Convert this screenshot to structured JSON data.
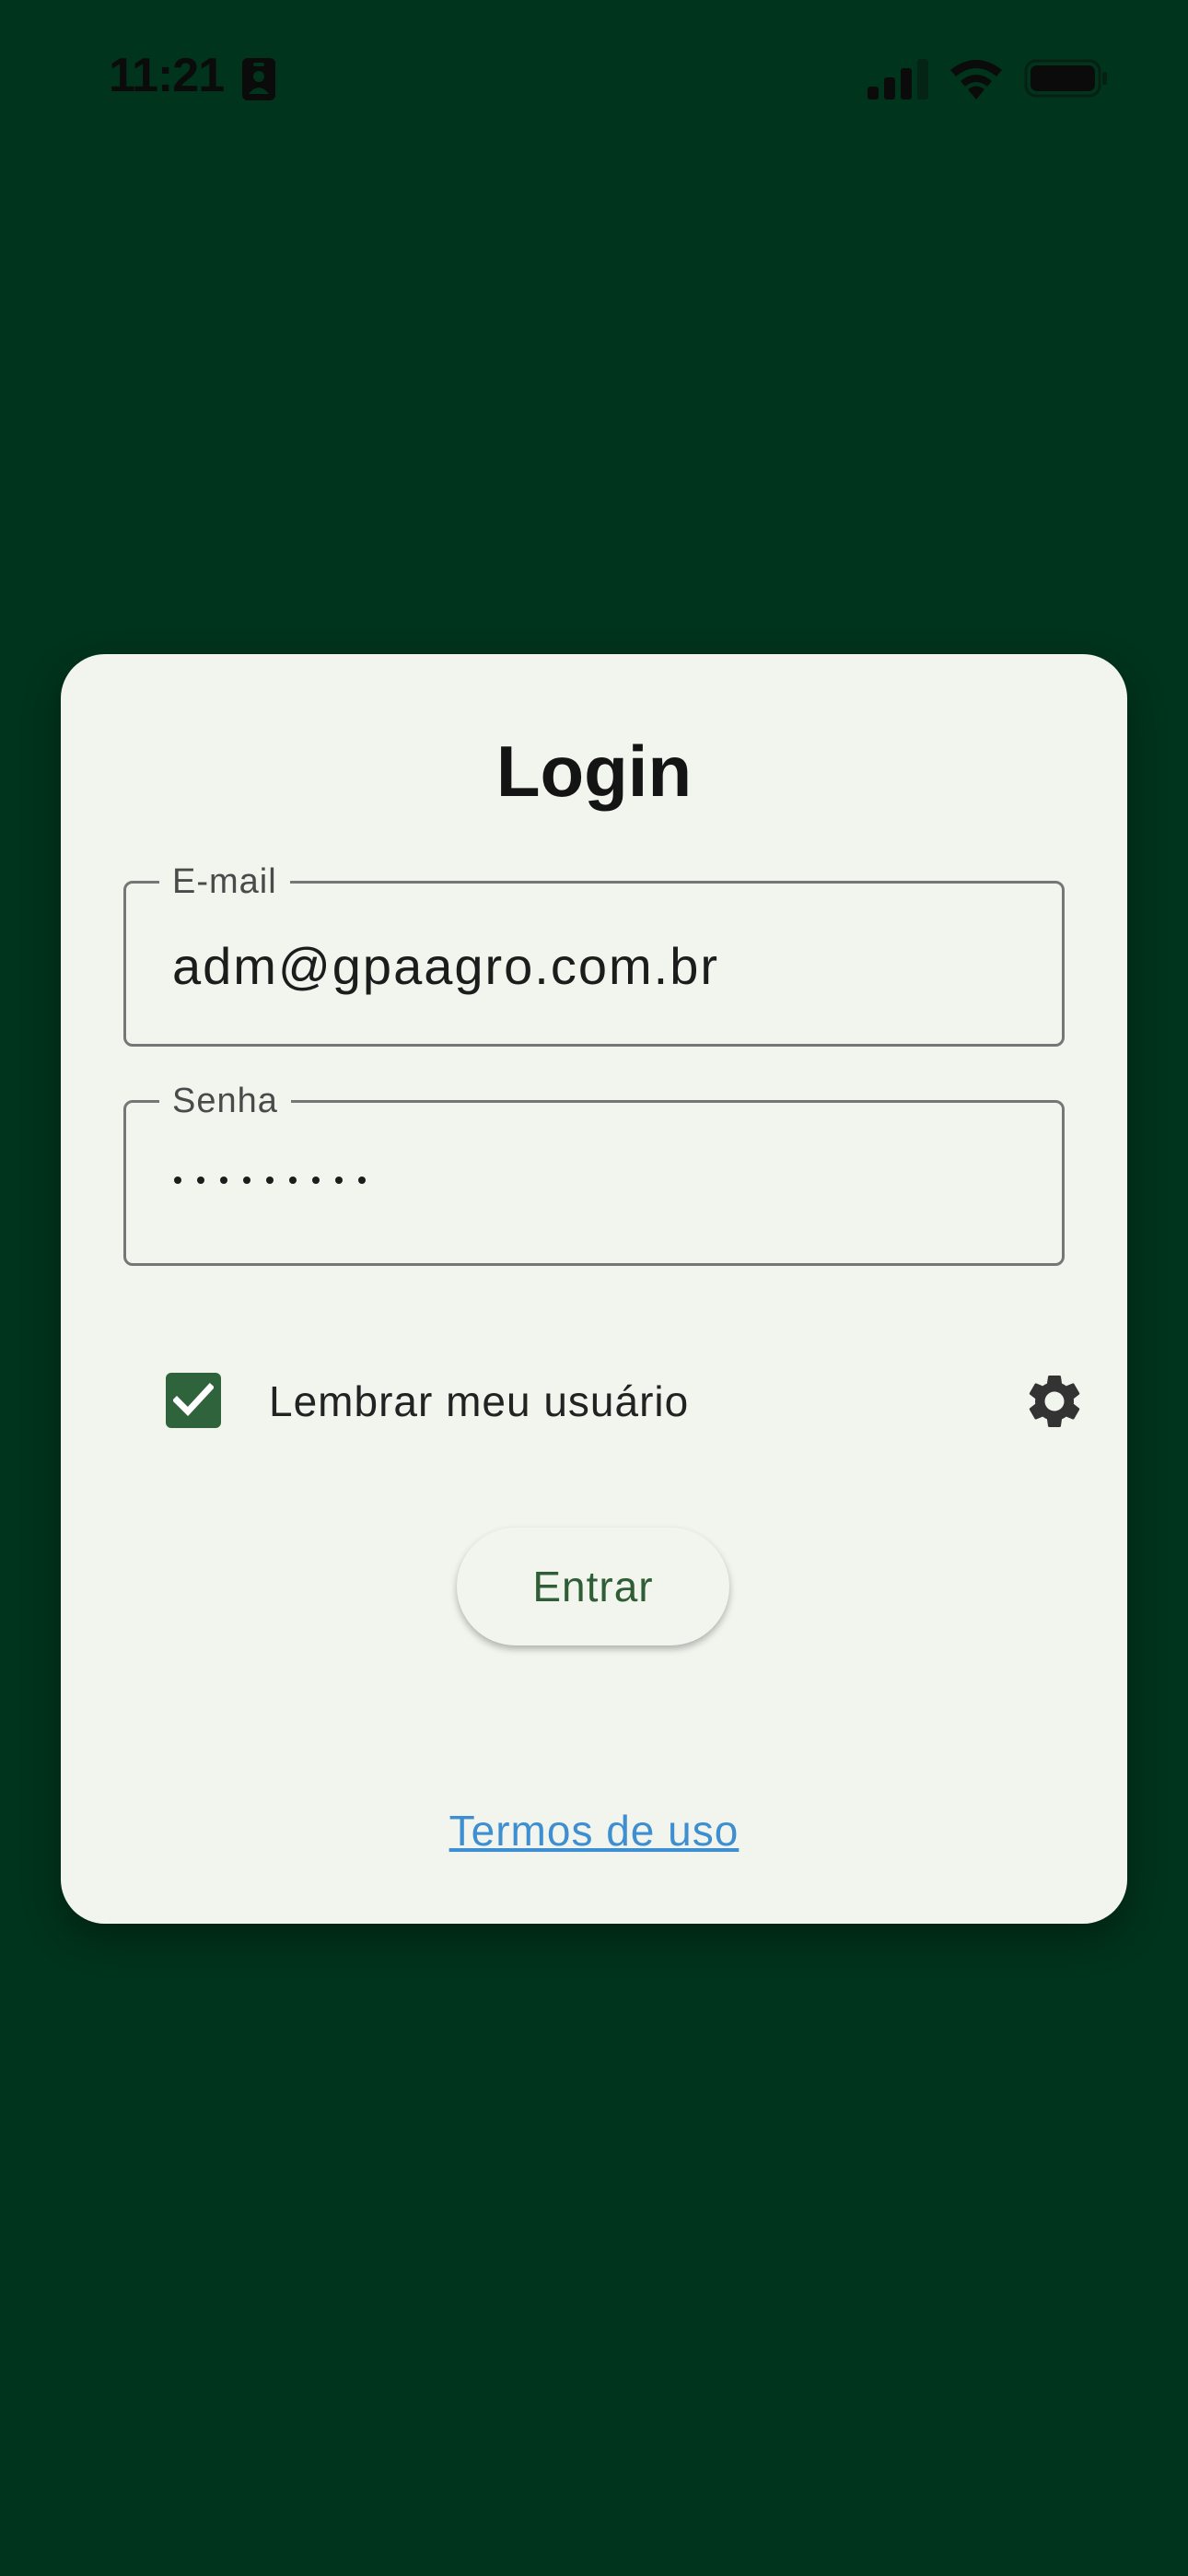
{
  "status_bar": {
    "time": "11:21",
    "badge_icon": "contact-card-icon",
    "signal_icon": "cellular-signal-icon",
    "wifi_icon": "wifi-icon",
    "battery_icon": "battery-icon"
  },
  "login": {
    "title": "Login",
    "email_label": "E-mail",
    "email_value": "adm@gpaagro.com.br",
    "password_label": "Senha",
    "password_masked": "•••••••••",
    "remember_label": "Lembrar meu usuário",
    "remember_checked": true,
    "settings_icon": "gear-icon",
    "submit_label": "Entrar",
    "terms_link": "Termos de uso"
  },
  "colors": {
    "background": "#01341c",
    "card": "#f2f4ee",
    "accent": "#2f633b",
    "link": "#3d8fd1"
  }
}
